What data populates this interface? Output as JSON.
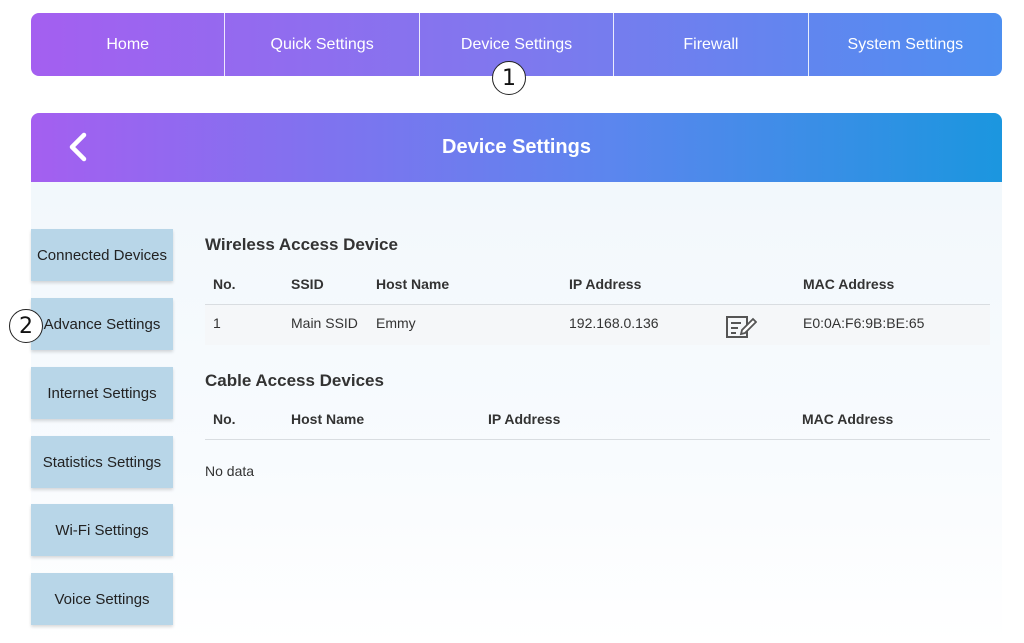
{
  "topnav": {
    "tabs": [
      "Home",
      "Quick Settings",
      "Device Settings",
      "Firewall",
      "System Settings"
    ]
  },
  "markers": {
    "one": "1",
    "two": "2"
  },
  "header": {
    "title": "Device Settings"
  },
  "sidebar": {
    "items": [
      "Connected Devices",
      "Advance Settings",
      "Internet Settings",
      "Statistics Settings",
      "Wi-Fi Settings",
      "Voice Settings"
    ]
  },
  "wireless": {
    "title": "Wireless Access Device",
    "headers": {
      "no": "No.",
      "ssid": "SSID",
      "host": "Host Name",
      "ip": "IP Address",
      "mac": "MAC Address"
    },
    "rows": [
      {
        "no": "1",
        "ssid": "Main SSID",
        "host": "Emmy",
        "ip": "192.168.0.136",
        "mac": "E0:0A:F6:9B:BE:65"
      }
    ]
  },
  "cable": {
    "title": "Cable Access Devices",
    "headers": {
      "no": "No.",
      "host": "Host Name",
      "ip": "IP Address",
      "mac": "MAC Address"
    },
    "empty": "No data"
  },
  "icons": {
    "back": "chevron-left-icon",
    "edit": "edit-icon"
  },
  "colors": {
    "sidebar_bg": "#b8d6e8",
    "gradient_start": "#a45ff0",
    "gradient_end": "#1b96df"
  }
}
